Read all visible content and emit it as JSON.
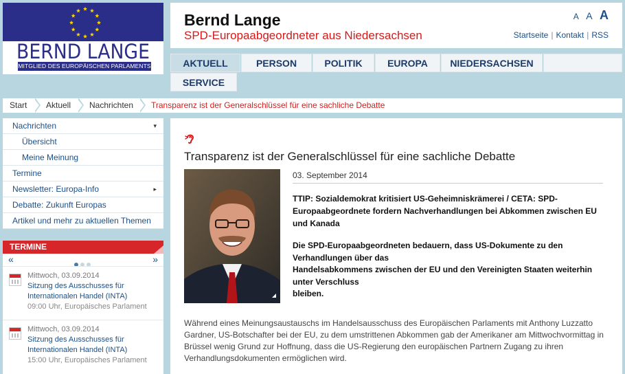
{
  "logo": {
    "name": "BERND LANGE",
    "subline": "MITGLIED DES EUROPÄISCHEN PARLAMENTS",
    "colors": {
      "flag": "#2b2e88",
      "stars": "#ffd700"
    }
  },
  "header": {
    "title": "Bernd Lange",
    "subtitle": "SPD-Europaabgeordneter aus Niedersachsen",
    "font_size_controls": [
      "A",
      "A",
      "A"
    ],
    "links": [
      "Startseite",
      "Kontakt",
      "RSS"
    ]
  },
  "nav": {
    "tabs": [
      "AKTUELL",
      "PERSON",
      "POLITIK",
      "EUROPA",
      "NIEDERSACHSEN",
      "SERVICE"
    ],
    "active": "AKTUELL"
  },
  "breadcrumb": [
    "Start",
    "Aktuell",
    "Nachrichten",
    "Transparenz ist der Generalschlüssel für eine sachliche Debatte"
  ],
  "sidebar": {
    "items": [
      {
        "label": "Nachrichten",
        "icon": "caret-down-icon",
        "caret": "▾"
      },
      {
        "label": "Übersicht"
      },
      {
        "label": "Meine Meinung"
      },
      {
        "label": "Termine"
      },
      {
        "label": "Newsletter: Europa-Info",
        "icon": "caret-right-icon",
        "caret": "▸"
      },
      {
        "label": "Debatte: Zukunft Europas"
      },
      {
        "label": "Artikel und mehr zu aktuellen Themen"
      }
    ]
  },
  "termine": {
    "heading": "TERMINE",
    "prev": "«",
    "next": "»",
    "pages": 3,
    "current_page": 1,
    "events": [
      {
        "date": "Mittwoch, 03.09.2014",
        "title": "Sitzung des Ausschusses für Internationalen Handel (INTA)",
        "meta": "09:00 Uhr, Europäisches Parlament"
      },
      {
        "date": "Mittwoch, 03.09.2014",
        "title": "Sitzung des Ausschusses für Internationalen Handel (INTA)",
        "meta": "15:00 Uhr, Europäisches Parlament"
      }
    ]
  },
  "article": {
    "title": "Transparenz ist der Generalschlüssel für eine sachliche Debatte",
    "date": "03. September 2014",
    "lead": "TTIP: Sozialdemokrat kritisiert US-Geheimniskrämerei / CETA: SPD-Europaabgeordnete fordern Nachverhandlungen bei Abkommen zwischen EU und Kanada",
    "lead2_lines": [
      "Die SPD-Europaabgeordneten bedauern, dass US-Dokumente zu den Verhandlungen über das",
      "Handelsabkommens zwischen der EU und den Vereinigten Staaten weiterhin unter Verschluss",
      "bleiben."
    ],
    "body": "Während eines Meinungsaustauschs im Handelsausschuss des Europäischen Parlaments mit Anthony Luzzatto Gardner, US-Botschafter bei der EU, zu dem umstrittenen Abkommen gab der Amerikaner am Mittwochvormittag in Brüssel wenig Grund zur Hoffnung, dass die US-Regierung den europäischen Partnern Zugang zu ihren Verhandlungsdokumenten ermöglichen wird."
  },
  "colors": {
    "page_bg": "#b7d6df",
    "accent_red": "#d51a1a",
    "link_blue": "#1b4f87",
    "nav_text": "#1e3a66"
  }
}
